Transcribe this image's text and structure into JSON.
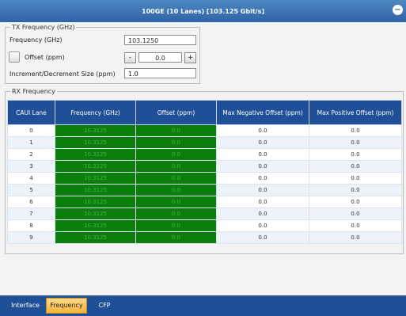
{
  "window": {
    "title": "100GE (10 Lanes) [103.125 Gbit/s]",
    "close_icon": "−"
  },
  "tx": {
    "legend": "TX Frequency (GHz)",
    "frequency_label": "Frequency (GHz)",
    "frequency_value": "103.1250",
    "offset_label": "Offset (ppm)",
    "offset_value": "0.0",
    "minus": "-",
    "plus": "+",
    "increment_label": "Increment/Decrement Size (ppm)",
    "increment_value": "1.0"
  },
  "rx": {
    "legend": "RX Frequency",
    "headers": [
      "CAUI Lane",
      "Frequency (GHz)",
      "Offset (ppm)",
      "Max Negative Offset (ppm)",
      "Max Positive Offset (ppm)"
    ],
    "rows": [
      [
        "0",
        "10.3125",
        "0.0",
        "0.0",
        "0.0"
      ],
      [
        "1",
        "10.3125",
        "0.0",
        "0.0",
        "0.0"
      ],
      [
        "2",
        "10.3125",
        "0.0",
        "0.0",
        "0.0"
      ],
      [
        "3",
        "10.3125",
        "0.0",
        "0.0",
        "0.0"
      ],
      [
        "4",
        "10.3125",
        "0.0",
        "0.0",
        "0.0"
      ],
      [
        "5",
        "10.3125",
        "0.0",
        "0.0",
        "0.0"
      ],
      [
        "6",
        "10.3125",
        "0.0",
        "0.0",
        "0.0"
      ],
      [
        "7",
        "10.3125",
        "0.0",
        "0.0",
        "0.0"
      ],
      [
        "8",
        "10.3125",
        "0.0",
        "0.0",
        "0.0"
      ],
      [
        "9",
        "10.3125",
        "0.0",
        "0.0",
        "0.0"
      ]
    ]
  },
  "tabs": [
    "Interface",
    "Frequency",
    "CFP"
  ],
  "colors": {
    "header": "#1f4f96",
    "status_ok": "#0a7d0a",
    "active_tab": "#f5b43b"
  }
}
